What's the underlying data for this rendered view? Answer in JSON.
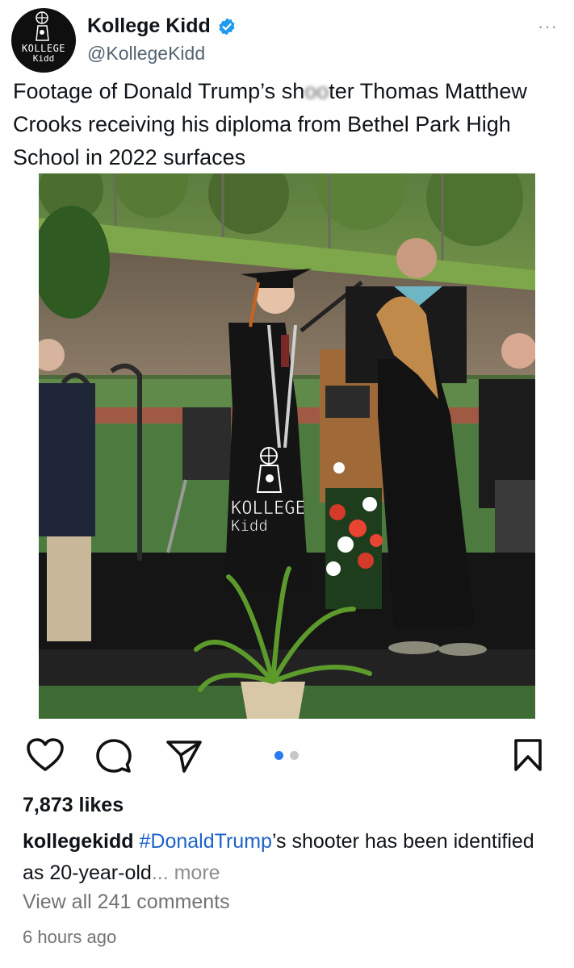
{
  "account": {
    "display_name": "Kollege Kidd",
    "handle": "@KollegeKidd",
    "avatar_text_1": "KOLLEGE",
    "avatar_text_2": "Kidd",
    "verified_color": "#1d9bf0"
  },
  "tweet": {
    "text_part1": "Footage of Donald Trump’s sh",
    "text_blurred": "oo",
    "text_part2": "ter Thomas Matthew Crooks receiving his diploma from Bethel Park High School in 2022 surfaces"
  },
  "photo": {
    "watermark_1": "KOLLEGE",
    "watermark_2": "Kidd"
  },
  "post": {
    "likes": "7,873 likes",
    "caption_user": "kollegekidd",
    "caption_tag": "#DonaldTrump",
    "caption_text": "’s shooter has been identified as 20-year-old",
    "caption_more": "... more",
    "view_comments": "View all 241 comments",
    "time": "6 hours ago",
    "carousel_index": 1,
    "carousel_count": 2,
    "accent_color": "#2a7bf0"
  },
  "icons": {
    "like": "heart-icon",
    "comment": "comment-bubble-icon",
    "share": "paper-plane-icon",
    "save": "bookmark-icon",
    "menu": "more-dots-icon"
  }
}
